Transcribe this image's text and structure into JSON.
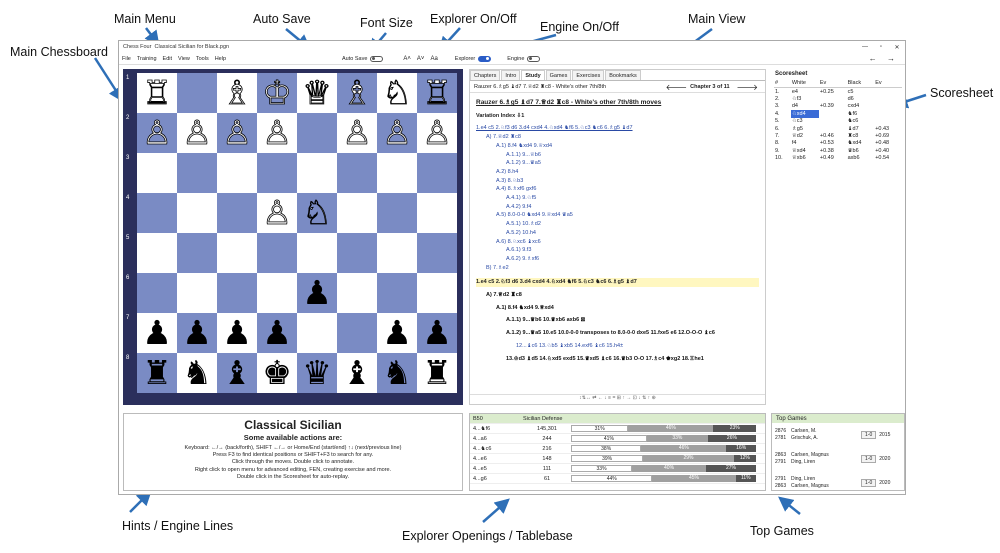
{
  "callouts": {
    "main_chessboard": "Main Chessboard",
    "main_menu": "Main Menu",
    "auto_save": "Auto Save",
    "font_size": "Font Size",
    "explorer_onoff": "Explorer On/Off",
    "engine_onoff": "Engine On/Off",
    "main_view": "Main View",
    "scoresheet": "Scoresheet",
    "hints_engine": "Hints / Engine Lines",
    "explorer_tablebase": "Explorer Openings / Tablebase",
    "top_games": "Top Games"
  },
  "window": {
    "app_name": "Chess Four",
    "file_name": "Classical Sicilian for Black.pgn",
    "min": "—",
    "max": "▫",
    "close": "✕"
  },
  "menu": [
    "File",
    "Training",
    "Edit",
    "View",
    "Tools",
    "Help"
  ],
  "toolbar": {
    "auto_save": "Auto Save",
    "font_a1": "A˄",
    "font_a2": "A˅",
    "font_a3": "Aa",
    "explorer": "Explorer",
    "engine": "Engine",
    "nav": "← →"
  },
  "board": {
    "ranks": [
      "1",
      "2",
      "3",
      "4",
      "5",
      "6",
      "7",
      "8"
    ],
    "files": [
      "h",
      "g",
      "f",
      "e",
      "d",
      "c",
      "b",
      "a"
    ],
    "rows": [
      [
        "wR",
        "",
        "wB",
        "wK",
        "wQ",
        "wB",
        "wN",
        "wR"
      ],
      [
        "wP",
        "wP",
        "wP",
        "wP",
        "",
        "wP",
        "wP",
        "wP"
      ],
      [
        "",
        "",
        "",
        "",
        "",
        "",
        "",
        ""
      ],
      [
        "",
        "",
        "",
        "wP",
        "wN",
        "",
        "",
        ""
      ],
      [
        "",
        "",
        "",
        "",
        "",
        "",
        "",
        ""
      ],
      [
        "",
        "",
        "",
        "",
        "bP",
        "",
        "",
        ""
      ],
      [
        "bP",
        "bP",
        "bP",
        "bP",
        "",
        "",
        "bP",
        "bP"
      ],
      [
        "bR",
        "bN",
        "bB",
        "bK",
        "bQ",
        "bB",
        "bN",
        "bR"
      ]
    ]
  },
  "tabs": [
    "Chapters",
    "Intro",
    "Study",
    "Games",
    "Exercises",
    "Bookmarks"
  ],
  "chapter": {
    "title": "Rauzer 6.♗g5 ♝d7 7.♕d2 ♜c8 - White's other 7th/8th",
    "counter": "Chapter 3 of 11",
    "left": "🡐",
    "right": "🡒"
  },
  "study": {
    "heading": "Rauzer 6.♗g5 ♝d7 7.♕d2 ♜c8 - White's other 7th/8th moves",
    "index": "Variation Index ⇩1",
    "lines": [
      "1.e4 c5 2.♘f3 d6 3.d4 cxd4 4.♘xd4 ♞f6 5.♘c3 ♞c6 6.♗g5 ♝d7",
      "A) 7.♕d2 ♜c8",
      "A.1) 8.f4 ♞xd4 9.♕xd4",
      "A.1.1) 9...♕b6",
      "A.1.2) 9...♛a5",
      "A.2) 8.h4",
      "A.3) 8.♘b3",
      "A.4) 8.♗xf6 gxf6",
      "A.4.1) 9.♘f5",
      "A.4.2) 9.f4",
      "A.5) 8.0-0-0 ♞xd4 9.♕xd4 ♛a5",
      "A.5.1) 10.♗d2",
      "A.5.2) 10.h4",
      "A.6) 8.♘xc6 ♝xc6",
      "A.6.1) 9.f3",
      "A.6.2) 9.♗xf6",
      "B) 7.♗e2"
    ],
    "main": "1.e4 c5 2.♘f3 d6 3.d4 cxd4 4.♘xd4 ♞f6 5.♘c3 ♞c6 6.♗g5 ♝d7",
    "a": "A) 7.♕d2 ♜c8",
    "a1": "A.1) 8.f4 ♞xd4 9.♕xd4",
    "a11": "A.1.1) 9...♛b6 10.♛xb6 axb6 ⊠",
    "a12": "A.1.2) 9...♛a5 10.e5 10.0-0-0 transposes to 8.0-0-0 dxe5 11.fxe5 e6 12.O-O-O ♝c6",
    "a12b": "12...♝c6 13.♘b5 ♝xb5 14.exf6 ♝c6 15.h4±",
    "a12c": "13.♔d3 ♝d5 14.♘xd5 exd5 15.♛xd5 ♝c6 16.♛b3 O-O 17.♗c4 ♚xg2 18.♖he1",
    "bar": "↕⇅↔ ⇄ ← ↓ ≡ = ⊞ ↑ → ⊡ ↓ ⇅ ↑ ⊕"
  },
  "scoresheet": {
    "title": "Scoresheet",
    "headers": [
      "#",
      "White",
      "Ev",
      "Black",
      "Ev"
    ],
    "rows": [
      [
        "1.",
        "e4",
        "+0.25",
        "c5",
        ""
      ],
      [
        "2.",
        "♘f3",
        "",
        "d6",
        ""
      ],
      [
        "3.",
        "d4",
        "+0.39",
        "cxd4",
        ""
      ],
      [
        "4.",
        "♘xd4",
        "",
        "♞f6",
        ""
      ],
      [
        "5.",
        "♘c3",
        "",
        "♞c6",
        ""
      ],
      [
        "6.",
        "♗g5",
        "",
        "♝d7",
        "+0.43"
      ],
      [
        "7.",
        "♕d2",
        "+0.46",
        "♜c8",
        "+0.69"
      ],
      [
        "8.",
        "f4",
        "+0.53",
        "♞xd4",
        "+0.48"
      ],
      [
        "9.",
        "♕xd4",
        "+0.38",
        "♛b6",
        "+0.40"
      ],
      [
        "10.",
        "♕xb6",
        "+0.49",
        "axb6",
        "+0.54"
      ]
    ]
  },
  "hints": {
    "title": "Classical Sicilian",
    "subtitle": "Some available actions are:",
    "lines": [
      "Keyboard: ←/→ (back/forth), SHIFT ←/→ or Home/End (start/end) ↑↓ (next/previous line)",
      "Press F3 to find identical positions or SHIFT+F3 to search for any.",
      "Click through the moves. Double click to annotate.",
      "Right click to open menu for advanced editing, FEN, creating exercise and more.",
      "Double click in the Scoresheet for auto-replay."
    ]
  },
  "explorer": {
    "eco": "B50",
    "name": "Sicilian Defense",
    "rows": [
      {
        "move": "4...♞f6",
        "count": "145,301",
        "w": "31%",
        "d": "46%",
        "b": "23%",
        "wv": 31,
        "dv": 46,
        "bv": 23
      },
      {
        "move": "4...a6",
        "count": "244",
        "w": "41%",
        "d": "33%",
        "b": "26%",
        "wv": 41,
        "dv": 33,
        "bv": 26
      },
      {
        "move": "4...♞c6",
        "count": "216",
        "w": "38%",
        "d": "46%",
        "b": "16%",
        "wv": 38,
        "dv": 46,
        "bv": 16
      },
      {
        "move": "4...e6",
        "count": "148",
        "w": "39%",
        "d": "29%",
        "b": "12%",
        "wv": 39,
        "dv": 49,
        "bv": 12
      },
      {
        "move": "4...e5",
        "count": "111",
        "w": "33%",
        "d": "40%",
        "b": "27%",
        "wv": 33,
        "dv": 40,
        "bv": 27
      },
      {
        "move": "4...g6",
        "count": "61",
        "w": "44%",
        "d": "45%",
        "b": "11%",
        "wv": 44,
        "dv": 45,
        "bv": 11
      }
    ]
  },
  "top_games": {
    "title": "Top Games",
    "games": [
      {
        "r1": "2876",
        "r2": "2781",
        "p1": "Carlsen, M.",
        "p2": "Grischuk, A.",
        "res": "1-0",
        "year": "2015"
      },
      {
        "r1": "2863",
        "r2": "2791",
        "p1": "Carlsen, Magnus",
        "p2": "Ding, Liren",
        "res": "1-0",
        "year": "2020"
      },
      {
        "r1": "2791",
        "r2": "2863",
        "p1": "Ding, Liren",
        "p2": "Carlsen, Magnus",
        "res": "1-0",
        "year": "2020"
      }
    ]
  }
}
